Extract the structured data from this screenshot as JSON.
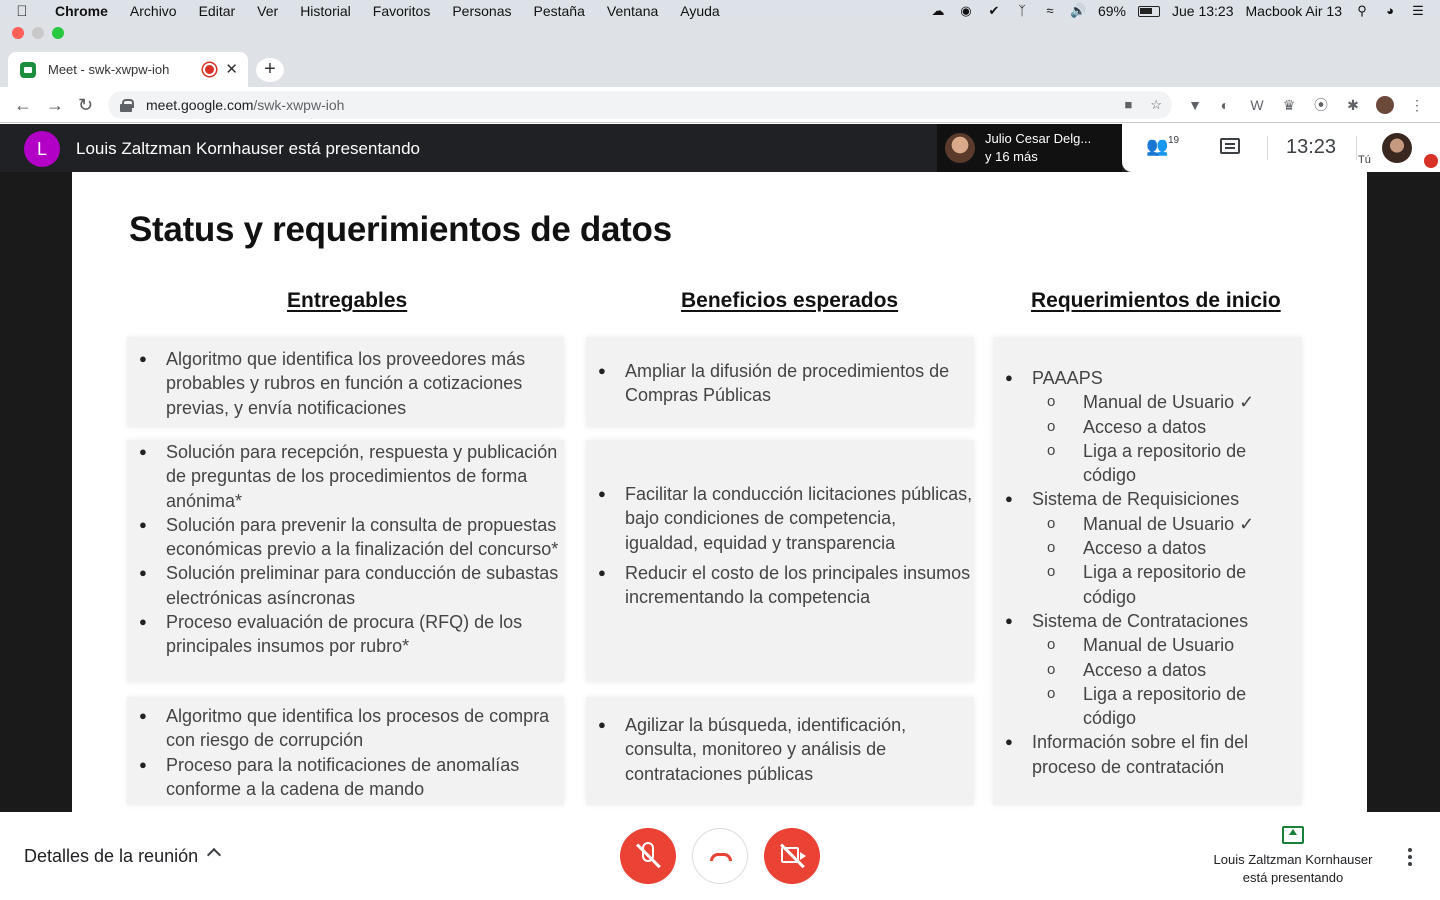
{
  "menubar": {
    "app": "Chrome",
    "items": [
      "Archivo",
      "Editar",
      "Ver",
      "Historial",
      "Favoritos",
      "Personas",
      "Pestaña",
      "Ventana",
      "Ayuda"
    ],
    "battery": "69%",
    "clock": "Jue 13:23",
    "device": "Macbook Air 13"
  },
  "browser": {
    "tab_title": "Meet - swk-xwpw-ioh",
    "url_host": "meet.google.com",
    "url_path": "/swk-xwpw-ioh"
  },
  "meet": {
    "presenter_initial": "L",
    "presenting_label": "Louis Zaltzman Kornhauser está presentando",
    "participant_name": "Julio Cesar Delg...",
    "participant_more": "y 16 más",
    "people_count": "19",
    "time": "13:23",
    "self_label": "Tú",
    "meeting_details": "Detalles de la reunión",
    "presenter_footer_line1": "Louis Zaltzman Kornhauser",
    "presenter_footer_line2": "está presentando"
  },
  "slide": {
    "title": "Status y requerimientos de datos",
    "columns": [
      "Entregables",
      "Beneficios esperados",
      "Requerimientos de inicio"
    ],
    "entregables": [
      [
        "Algoritmo que identifica los proveedores más probables y rubros en función a cotizaciones previas, y envía notificaciones"
      ],
      [
        "Solución para recepción, respuesta y publicación de preguntas de los procedimientos de forma anónima*",
        "Solución para prevenir la consulta de propuestas económicas previo a la finalización del concurso*",
        "Solución preliminar para conducción de subastas electrónicas asíncronas",
        "Proceso evaluación de procura (RFQ) de los principales insumos por rubro*"
      ],
      [
        "Algoritmo que identifica los procesos de compra con riesgo de corrupción",
        "Proceso para la notificaciones de anomalías conforme a la cadena de mando"
      ]
    ],
    "beneficios": [
      [
        "Ampliar la difusión de procedimientos de Compras Públicas"
      ],
      [
        "Facilitar la conducción licitaciones públicas, bajo condiciones de competencia, igualdad, equidad y transparencia",
        "Reducir el costo de los principales insumos incrementando la competencia"
      ],
      [
        "Agilizar la búsqueda, identificación, consulta, monitoreo y análisis de contrataciones públicas"
      ]
    ],
    "requerimientos": {
      "g1": "PAAAPS",
      "g1_items": [
        "Manual de Usuario ✓",
        "Acceso a datos",
        "Liga a repositorio de código"
      ],
      "g2": "Sistema de Requisiciones",
      "g2_items": [
        "Manual de Usuario ✓",
        "Acceso a datos",
        "Liga a repositorio de código"
      ],
      "g3": "Sistema de Contrataciones",
      "g3_items": [
        "Manual de Usuario",
        "Acceso a datos",
        "Liga a repositorio de código"
      ],
      "g4": "Información sobre el fin del proceso de contratación"
    }
  }
}
